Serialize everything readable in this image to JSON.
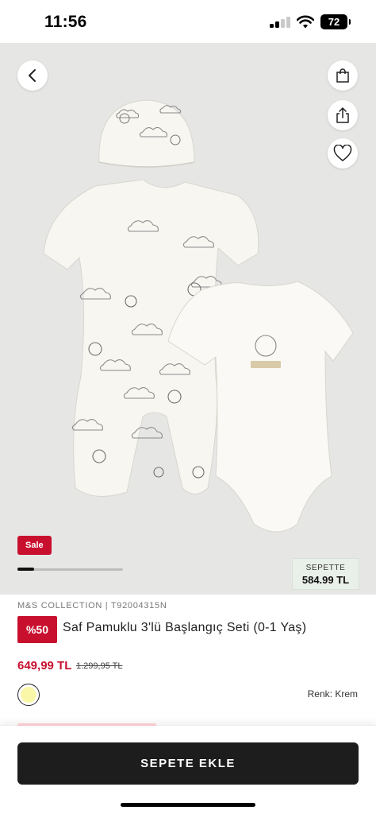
{
  "status_bar": {
    "time": "11:56",
    "battery": "72",
    "icons": [
      "signal-icon",
      "wifi-icon",
      "battery-icon"
    ]
  },
  "gallery": {
    "icons": {
      "back": "chevron-left-icon",
      "bag": "shopping-bag-icon",
      "share": "share-icon",
      "favorite": "heart-icon"
    },
    "sale_tag": "Sale",
    "slide_progress": 0.16,
    "basket_label": "SEPETTE",
    "basket_price": "584.99 TL"
  },
  "product": {
    "brand_line": "M&S COLLECTION | T92004315N",
    "discount": "%50",
    "title": "Saf Pamuklu 3'lü Başlangıç Seti (0-1 Yaş)",
    "price": "649,99 TL",
    "old_price": "1.299,95 TL",
    "color_label": "Renk: Krem",
    "swatch_color": "#fbf7a8"
  },
  "bottom_bar": {
    "add_to_cart": "SEPETE EKLE"
  },
  "colors": {
    "accent_red": "#c8102e",
    "gallery_bg": "#e6e6e5",
    "button_dark": "#1d1d1d",
    "basket_bg": "#e9efe9"
  }
}
